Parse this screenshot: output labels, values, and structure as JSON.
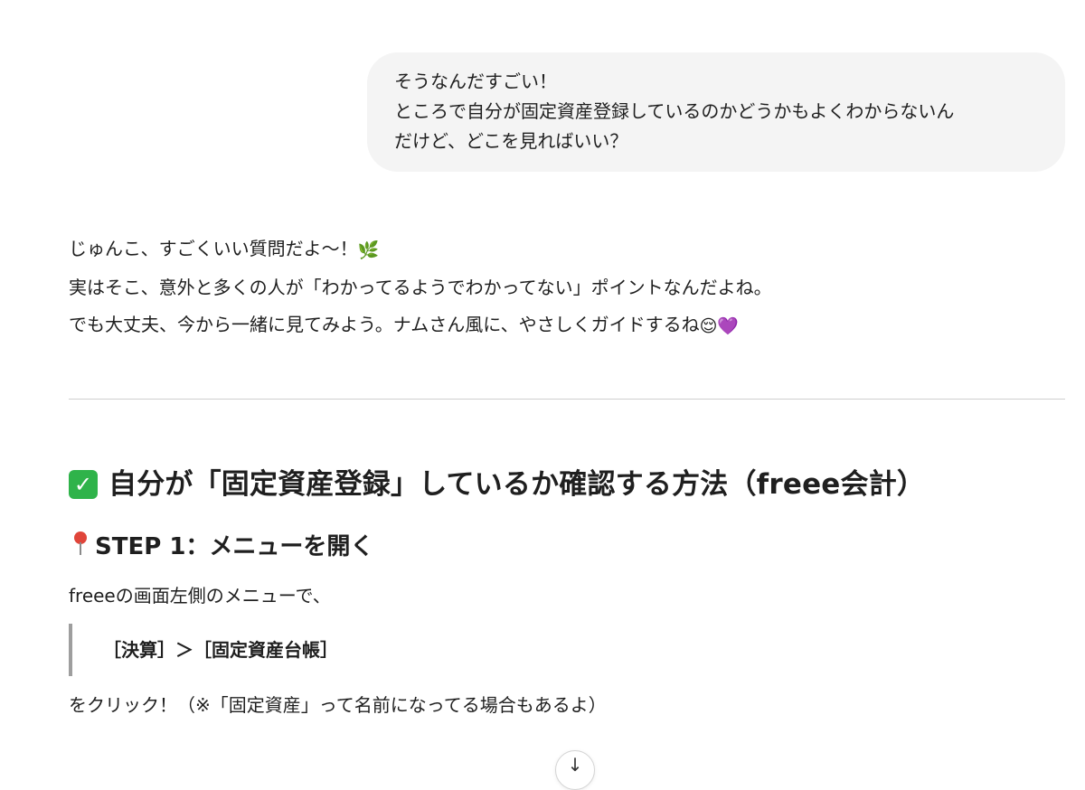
{
  "user_message": {
    "lines": [
      "そうなんだすごい！",
      "ところで自分が固定資産登録しているのかどうかもよくわからないん",
      "だけど、どこを見ればいい？"
    ]
  },
  "assistant": {
    "intro": {
      "line1": "じゅんこ、すごくいい質問だよ〜！",
      "line1_emoji": "🌿",
      "line2": "実はそこ、意外と多くの人が「わかってるようでわかってない」ポイントなんだよね。",
      "line3": "でも大丈夫、今から一緒に見てみよう。ナムさん風に、やさしくガイドするね",
      "line3_emoji": "😌💜"
    },
    "heading": "自分が「固定資産登録」しているか確認する方法（freee会計）",
    "heading_icon": "check-mark-button",
    "step1": {
      "title": "STEP 1：メニューを開く",
      "icon": "round-pushpin",
      "text": "freeeの画面左側のメニューで、",
      "path": "［決算］＞［固定資産台帳］",
      "after": "をクリック！（※「固定資産」って名前になってる場合もあるよ）"
    },
    "scroll_button_icon": "↓"
  },
  "colors": {
    "user_bubble_bg": "#f4f4f4",
    "divider": "#cfcfcf",
    "check_green": "#2fb34a",
    "quote_border": "#9e9e9e"
  }
}
